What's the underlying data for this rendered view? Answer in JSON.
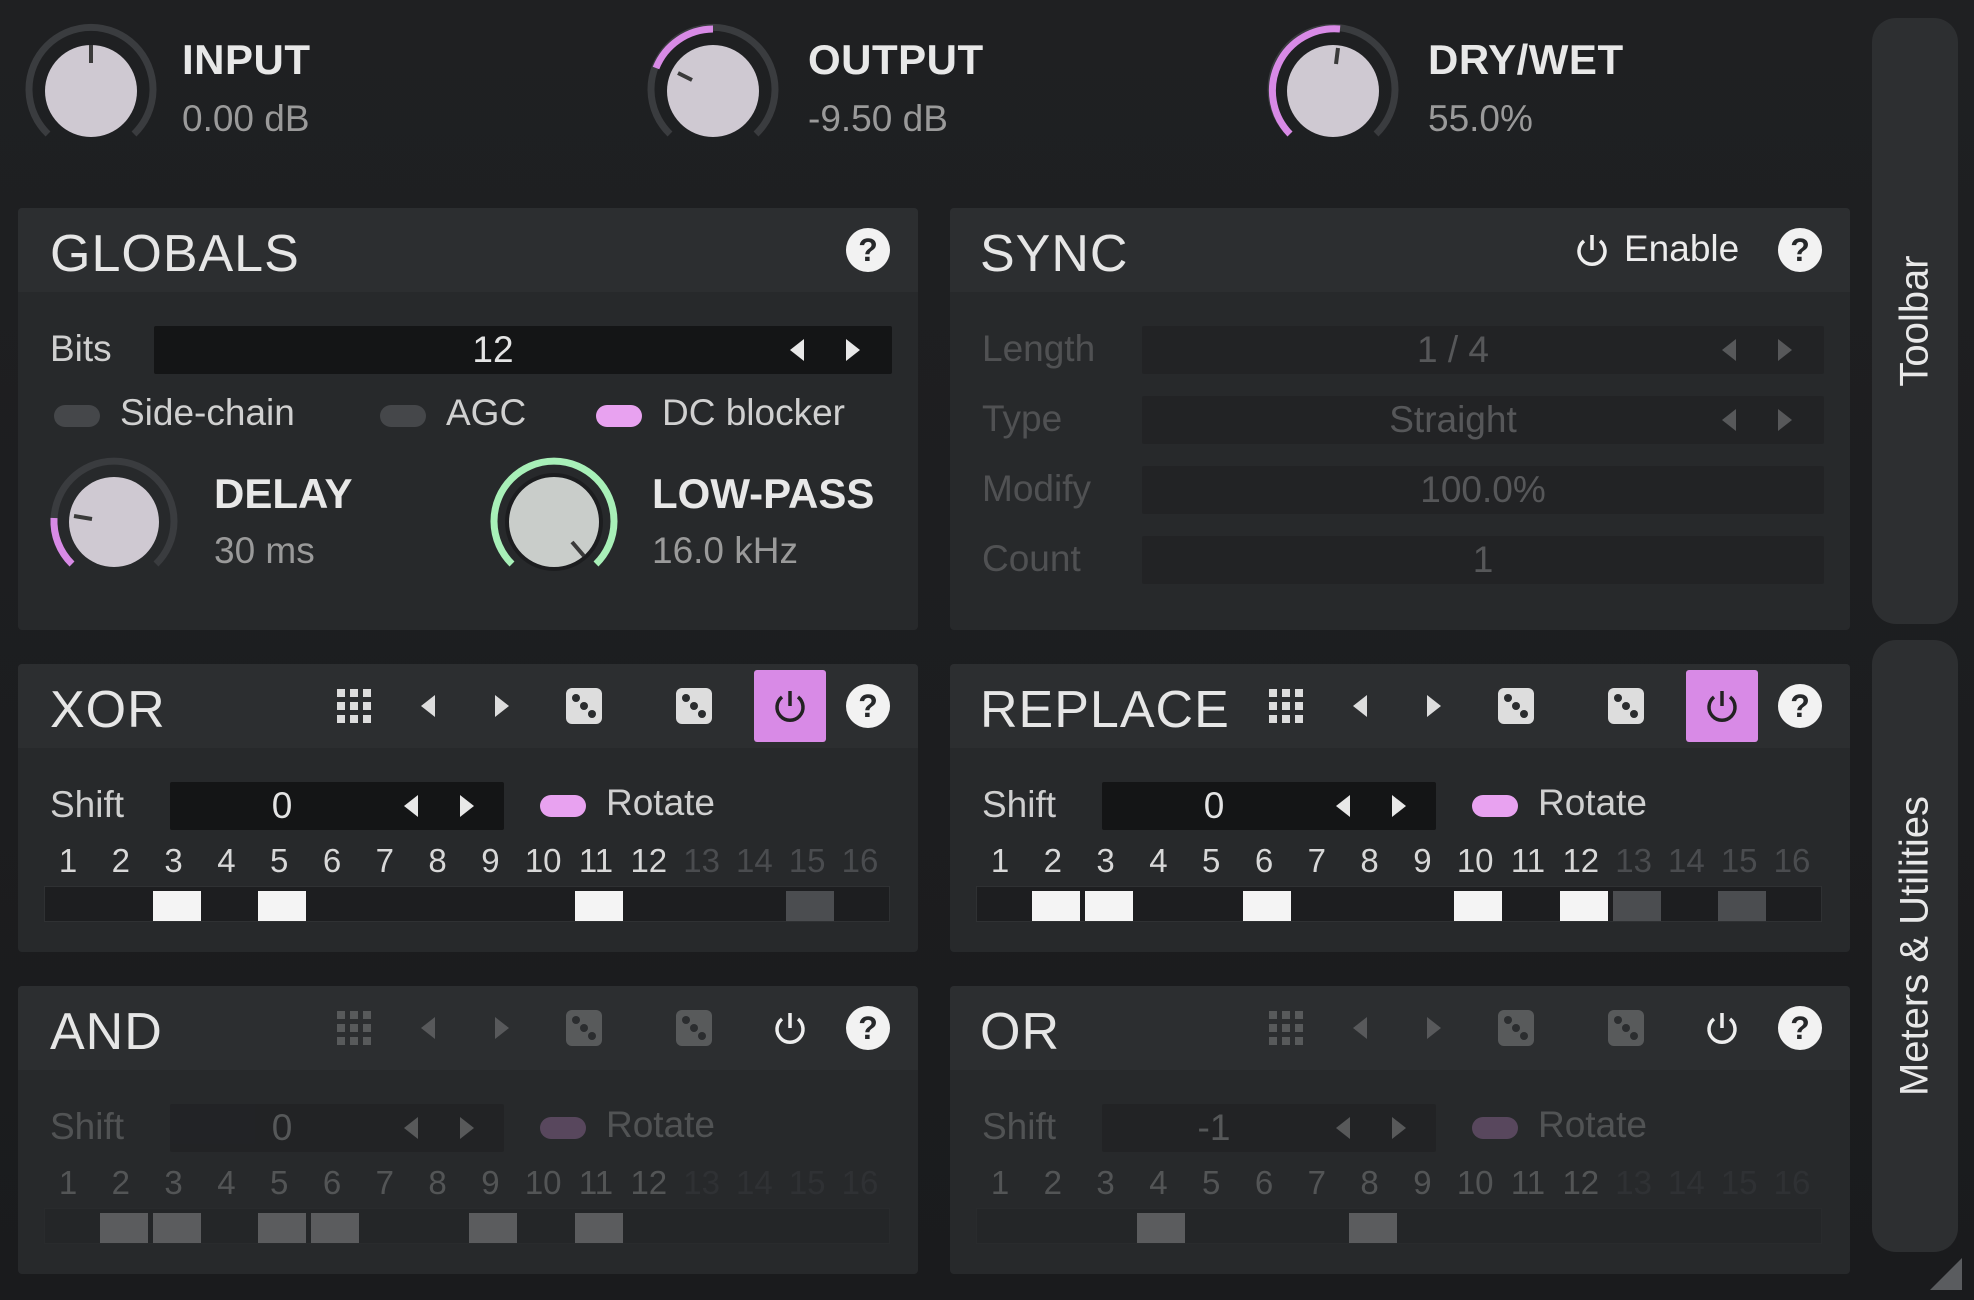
{
  "top_knobs": [
    {
      "label": "INPUT",
      "value": "0.00 dB"
    },
    {
      "label": "OUTPUT",
      "value": "-9.50 dB"
    },
    {
      "label": "DRY/WET",
      "value": "55.0%"
    }
  ],
  "globals": {
    "title": "GLOBALS",
    "help": "?",
    "bits_label": "Bits",
    "bits_value": "12",
    "sidechain_label": "Side-chain",
    "agc_label": "AGC",
    "dcblocker_label": "DC blocker",
    "delay": {
      "label": "DELAY",
      "value": "30 ms"
    },
    "lowpass": {
      "label": "LOW-PASS",
      "value": "16.0 kHz"
    }
  },
  "sync": {
    "title": "SYNC",
    "enable_label": "Enable",
    "help": "?",
    "length_label": "Length",
    "length_value": "1 / 4",
    "type_label": "Type",
    "type_value": "Straight",
    "modify_label": "Modify",
    "modify_value": "100.0%",
    "count_label": "Count",
    "count_value": "1"
  },
  "modules": [
    {
      "title": "XOR",
      "shift_label": "Shift",
      "shift_value": "0",
      "rotate_label": "Rotate",
      "help": "?"
    },
    {
      "title": "REPLACE",
      "shift_label": "Shift",
      "shift_value": "0",
      "rotate_label": "Rotate",
      "help": "?"
    },
    {
      "title": "AND",
      "shift_label": "Shift",
      "shift_value": "0",
      "rotate_label": "Rotate",
      "help": "?"
    },
    {
      "title": "OR",
      "shift_label": "Shift",
      "shift_value": "-1",
      "rotate_label": "Rotate",
      "help": "?"
    }
  ],
  "bit_numbers": [
    "1",
    "2",
    "3",
    "4",
    "5",
    "6",
    "7",
    "8",
    "9",
    "10",
    "11",
    "12",
    "13",
    "14",
    "15",
    "16"
  ],
  "sidetabs": {
    "toolbar": "Toolbar",
    "meters": "Meters & Utilities"
  },
  "colors": {
    "accent": "#d88ae6",
    "lowpass_ring": "#a8f0b8",
    "background": "#1b1c1e",
    "panel": "#27292b"
  },
  "icons": [
    "grid-icon",
    "arrow-left-icon",
    "arrow-right-icon",
    "dice-icon",
    "power-icon",
    "help-icon"
  ]
}
